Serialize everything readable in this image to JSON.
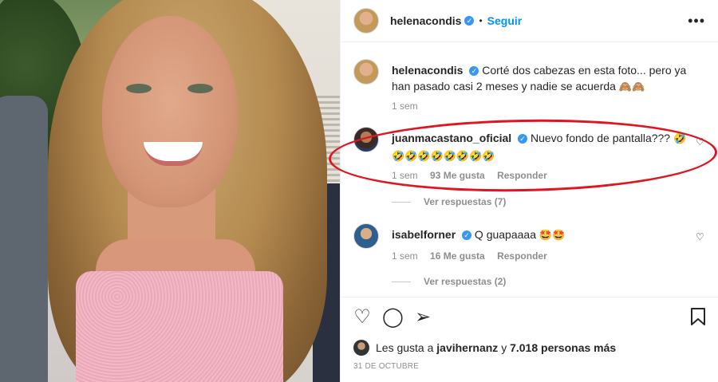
{
  "header": {
    "username": "helenacondis",
    "separator": "•",
    "follow_label": "Seguir",
    "more_icon": "more-icon"
  },
  "caption": {
    "username": "helenacondis",
    "text": "Corté dos cabezas en esta foto... pero ya han pasado casi 2 meses y nadie se acuerda",
    "emoji": "🙈🙈",
    "time": "1 sem"
  },
  "comments": [
    {
      "username": "juanmacastano_oficial",
      "text": "Nuevo fondo de pantalla???",
      "emoji": "🤣🤣🤣🤣🤣🤣🤣🤣🤣",
      "time": "1 sem",
      "likes": "93 Me gusta",
      "reply_label": "Responder",
      "view_replies": "Ver respuestas (7)"
    },
    {
      "username": "isabelforner",
      "text": "Q guapaaaa",
      "emoji": "🤩🤩",
      "time": "1 sem",
      "likes": "16 Me gusta",
      "reply_label": "Responder",
      "view_replies": "Ver respuestas (2)"
    }
  ],
  "likes_line": {
    "prefix": "Les gusta a",
    "user": "javihernanz",
    "connector": "y",
    "count": "7.018 personas más"
  },
  "date": "31 DE OCTUBRE",
  "colors": {
    "accent": "#0095f6",
    "highlight": "#e0151f",
    "muted": "#8e8e8e"
  }
}
